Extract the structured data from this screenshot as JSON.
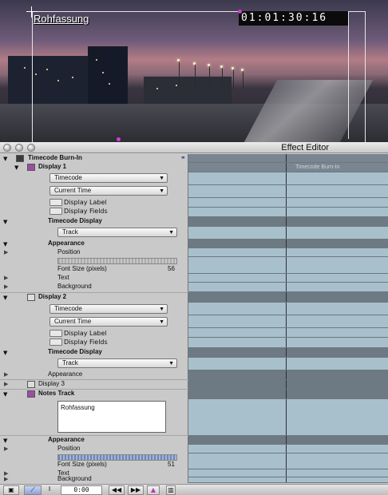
{
  "viewer": {
    "title_text": "Rohfassung",
    "timecode": "01:01:30:16"
  },
  "window": {
    "title": "Effect Editor"
  },
  "effect": {
    "name": "Timecode Burn-In",
    "track_label": "Timecode Burn-In",
    "display1": {
      "label": "Display 1",
      "type": "Timecode",
      "source": "Current Time",
      "display_label": "Display Label",
      "display_fields": "Display Fields",
      "tc_display_header": "Timecode Display",
      "tc_display_value": "Track",
      "appearance_header": "Appearance",
      "position_label": "Position",
      "font_size_label": "Font Size (pixels)",
      "font_size_value": "56",
      "text_label": "Text",
      "background_label": "Background"
    },
    "display2": {
      "label": "Display 2",
      "type": "Timecode",
      "source": "Current Time",
      "display_label": "Display Label",
      "display_fields": "Display Fields",
      "tc_display_header": "Timecode Display",
      "tc_display_value": "Track",
      "appearance_label": "Appearance"
    },
    "display3": {
      "label": "Display 3"
    },
    "notes": {
      "label": "Notes Track",
      "text": "Rohfassung",
      "appearance_header": "Appearance",
      "position_label": "Position",
      "font_size_label": "Font Size (pixels)",
      "font_size_value": "51",
      "text_label": "Text",
      "background_label": "Background"
    }
  },
  "toolbar": {
    "time": "0:00"
  }
}
